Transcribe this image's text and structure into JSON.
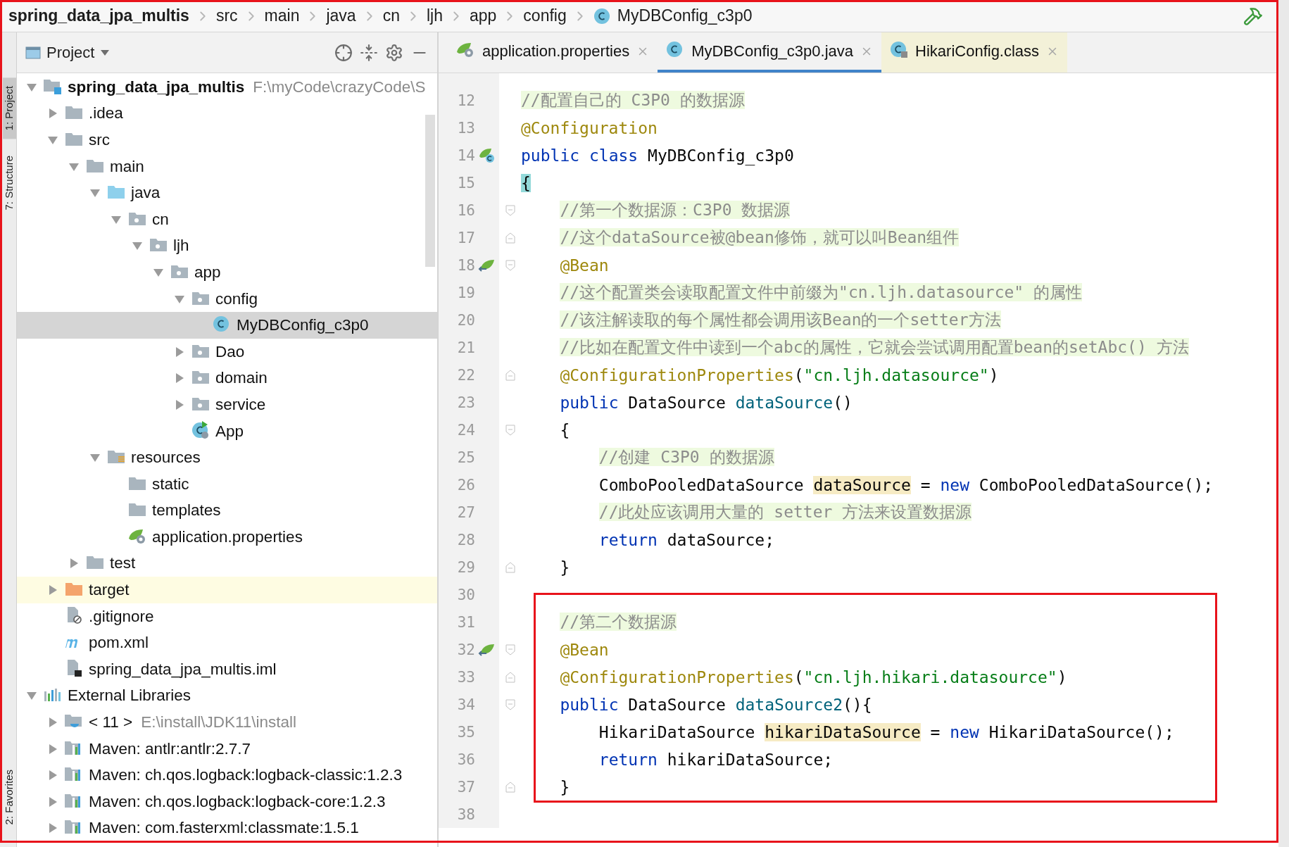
{
  "breadcrumbs": [
    {
      "label": "spring_data_jpa_multis",
      "kind": "project"
    },
    {
      "label": "src",
      "kind": "folder"
    },
    {
      "label": "main",
      "kind": "folder"
    },
    {
      "label": "java",
      "kind": "folder"
    },
    {
      "label": "cn",
      "kind": "folder"
    },
    {
      "label": "ljh",
      "kind": "folder"
    },
    {
      "label": "app",
      "kind": "folder"
    },
    {
      "label": "config",
      "kind": "folder"
    },
    {
      "label": "MyDBConfig_c3p0",
      "kind": "class"
    }
  ],
  "tool_strip": [
    {
      "label": "1: Project",
      "kind": "top",
      "selected": true
    },
    {
      "label": "7: Structure",
      "kind": "top",
      "selected": false
    },
    {
      "label": "2: Favorites",
      "kind": "bottom",
      "selected": false
    }
  ],
  "project_panel": {
    "title": "Project",
    "tree": [
      {
        "label": "spring_data_jpa_multis",
        "path": "F:\\myCode\\crazyCode\\S",
        "kind": "module",
        "expanded": true,
        "selected": false,
        "excluded": false,
        "children": [
          {
            "label": ".idea",
            "kind": "folder",
            "expanded": false,
            "selected": false,
            "excluded": false
          },
          {
            "label": "src",
            "kind": "folder",
            "expanded": true,
            "selected": false,
            "excluded": false,
            "children": [
              {
                "label": "main",
                "kind": "folder",
                "expanded": true,
                "selected": false,
                "excluded": false,
                "children": [
                  {
                    "label": "java",
                    "kind": "source",
                    "expanded": true,
                    "selected": false,
                    "excluded": false,
                    "children": [
                      {
                        "label": "cn",
                        "kind": "package",
                        "expanded": true,
                        "selected": false,
                        "excluded": false,
                        "children": [
                          {
                            "label": "ljh",
                            "kind": "package",
                            "expanded": true,
                            "selected": false,
                            "excluded": false,
                            "children": [
                              {
                                "label": "app",
                                "kind": "package",
                                "expanded": true,
                                "selected": false,
                                "excluded": false,
                                "children": [
                                  {
                                    "label": "config",
                                    "kind": "package",
                                    "expanded": true,
                                    "selected": false,
                                    "excluded": false,
                                    "children": [
                                      {
                                        "label": "MyDBConfig_c3p0",
                                        "kind": "class",
                                        "selected": true,
                                        "excluded": false
                                      }
                                    ]
                                  },
                                  {
                                    "label": "Dao",
                                    "kind": "package",
                                    "expanded": false,
                                    "selected": false,
                                    "excluded": false
                                  },
                                  {
                                    "label": "domain",
                                    "kind": "package",
                                    "expanded": false,
                                    "selected": false,
                                    "excluded": false
                                  },
                                  {
                                    "label": "service",
                                    "kind": "package",
                                    "expanded": false,
                                    "selected": false,
                                    "excluded": false
                                  },
                                  {
                                    "label": "App",
                                    "kind": "boot_class",
                                    "selected": false,
                                    "excluded": false
                                  }
                                ]
                              }
                            ]
                          }
                        ]
                      }
                    ]
                  },
                  {
                    "label": "resources",
                    "kind": "resources",
                    "expanded": true,
                    "selected": false,
                    "excluded": false,
                    "children": [
                      {
                        "label": "static",
                        "kind": "folder",
                        "selected": false,
                        "excluded": false
                      },
                      {
                        "label": "templates",
                        "kind": "folder",
                        "selected": false,
                        "excluded": false
                      },
                      {
                        "label": "application.properties",
                        "kind": "spring",
                        "selected": false,
                        "excluded": false
                      }
                    ]
                  }
                ]
              },
              {
                "label": "test",
                "kind": "folder",
                "expanded": false,
                "selected": false,
                "excluded": false
              }
            ]
          },
          {
            "label": "target",
            "kind": "excluded_folder",
            "expanded": false,
            "selected": false,
            "excluded": true
          },
          {
            "label": ".gitignore",
            "kind": "ignore_file",
            "selected": false,
            "excluded": false
          },
          {
            "label": "pom.xml",
            "kind": "maven",
            "selected": false,
            "excluded": false
          },
          {
            "label": "spring_data_jpa_multis.iml",
            "kind": "iml_file",
            "selected": false,
            "excluded": false
          }
        ]
      },
      {
        "label": "External Libraries",
        "kind": "libraries",
        "expanded": true,
        "selected": false,
        "excluded": false,
        "children": [
          {
            "label": "< 11 >",
            "path": "E:\\install\\JDK11\\install",
            "kind": "jdk",
            "expanded": false,
            "selected": false,
            "excluded": false
          },
          {
            "label": "Maven: antlr:antlr:2.7.7",
            "kind": "library",
            "expanded": false,
            "selected": false,
            "excluded": false
          },
          {
            "label": "Maven: ch.qos.logback:logback-classic:1.2.3",
            "kind": "library",
            "expanded": false,
            "selected": false,
            "excluded": false
          },
          {
            "label": "Maven: ch.qos.logback:logback-core:1.2.3",
            "kind": "library",
            "expanded": false,
            "selected": false,
            "excluded": false
          },
          {
            "label": "Maven: com.fasterxml:classmate:1.5.1",
            "kind": "library",
            "expanded": false,
            "selected": false,
            "excluded": false
          }
        ]
      }
    ]
  },
  "editor_tabs": [
    {
      "label": "application.properties",
      "kind": "spring",
      "selected": false,
      "library": false
    },
    {
      "label": "MyDBConfig_c3p0.java",
      "kind": "class",
      "selected": true,
      "library": false
    },
    {
      "label": "HikariConfig.class",
      "kind": "locked_class",
      "selected": false,
      "library": true
    }
  ],
  "code_lines": [
    {
      "number": "12",
      "boxed": false,
      "tokens": [
        {
          "kind": "comment",
          "text": "//配置自己的 C3P0 的数据源"
        }
      ]
    },
    {
      "number": "13",
      "boxed": false,
      "tokens": [
        {
          "kind": "annotation",
          "text": "@Configuration"
        }
      ]
    },
    {
      "number": "14",
      "boxed": false,
      "gutter": [
        {
          "kind": "bean_class"
        }
      ],
      "tokens": [
        {
          "kind": "keyword",
          "text": "public"
        },
        {
          "kind": "keyword",
          "text": " class"
        },
        {
          "kind": "plain",
          "text": " MyDBConfig_c3p0"
        }
      ]
    },
    {
      "number": "15",
      "boxed": false,
      "tokens": [
        {
          "kind": "brace_match",
          "text": "{"
        }
      ]
    },
    {
      "number": "16",
      "boxed": false,
      "gutter": [
        {
          "kind": "fold_open"
        }
      ],
      "tokens": [
        {
          "kind": "comment",
          "text": "    //第一个数据源：C3P0 数据源"
        }
      ]
    },
    {
      "number": "17",
      "boxed": false,
      "gutter": [
        {
          "kind": "fold_close"
        }
      ],
      "tokens": [
        {
          "kind": "comment",
          "text": "    //这个dataSource被@bean修饰，就可以叫Bean组件"
        }
      ]
    },
    {
      "number": "18",
      "boxed": false,
      "gutter": [
        {
          "kind": "bean"
        },
        {
          "kind": "fold_open"
        }
      ],
      "tokens": [
        {
          "kind": "annotation",
          "text": "    @Bean"
        }
      ]
    },
    {
      "number": "19",
      "boxed": false,
      "tokens": [
        {
          "kind": "comment",
          "text": "    //这个配置类会读取配置文件中前缀为\"cn.ljh.datasource\" 的属性"
        }
      ]
    },
    {
      "number": "20",
      "boxed": false,
      "tokens": [
        {
          "kind": "comment",
          "text": "    //该注解读取的每个属性都会调用该Bean的一个setter方法"
        }
      ]
    },
    {
      "number": "21",
      "boxed": false,
      "tokens": [
        {
          "kind": "comment",
          "text": "    //比如在配置文件中读到一个abc的属性，它就会尝试调用配置bean的setAbc() 方法"
        }
      ]
    },
    {
      "number": "22",
      "boxed": false,
      "gutter": [
        {
          "kind": "fold_close"
        }
      ],
      "tokens": [
        {
          "kind": "annotation",
          "text": "    @ConfigurationProperties"
        },
        {
          "kind": "plain",
          "text": "("
        },
        {
          "kind": "string",
          "text": "\"cn.ljh.datasource\""
        },
        {
          "kind": "plain",
          "text": ")"
        }
      ]
    },
    {
      "number": "23",
      "boxed": false,
      "tokens": [
        {
          "kind": "keyword",
          "text": "    public"
        },
        {
          "kind": "plain",
          "text": " DataSource "
        },
        {
          "kind": "method",
          "text": "dataSource"
        },
        {
          "kind": "plain",
          "text": "()"
        }
      ]
    },
    {
      "number": "24",
      "boxed": false,
      "gutter": [
        {
          "kind": "fold_open"
        }
      ],
      "tokens": [
        {
          "kind": "plain",
          "text": "    {"
        }
      ]
    },
    {
      "number": "25",
      "boxed": false,
      "tokens": [
        {
          "kind": "comment",
          "text": "        //创建 C3P0 的数据源"
        }
      ]
    },
    {
      "number": "26",
      "boxed": false,
      "tokens": [
        {
          "kind": "plain",
          "text": "        ComboPooledDataSource "
        },
        {
          "kind": "usage",
          "text": "dataSource"
        },
        {
          "kind": "plain",
          "text": " = "
        },
        {
          "kind": "keyword",
          "text": "new"
        },
        {
          "kind": "plain",
          "text": " ComboPooledDataSource();"
        }
      ]
    },
    {
      "number": "27",
      "boxed": false,
      "tokens": [
        {
          "kind": "comment",
          "text": "        //此处应该调用大量的 setter 方法来设置数据源"
        }
      ]
    },
    {
      "number": "28",
      "boxed": false,
      "tokens": [
        {
          "kind": "keyword",
          "text": "        return"
        },
        {
          "kind": "plain",
          "text": " dataSource;"
        }
      ]
    },
    {
      "number": "29",
      "boxed": false,
      "gutter": [
        {
          "kind": "fold_close"
        }
      ],
      "tokens": [
        {
          "kind": "plain",
          "text": "    }"
        }
      ]
    },
    {
      "number": "30",
      "boxed": false
    },
    {
      "number": "31",
      "boxed": true,
      "tokens": [
        {
          "kind": "comment",
          "text": "    //第二个数据源"
        }
      ]
    },
    {
      "number": "32",
      "boxed": true,
      "gutter": [
        {
          "kind": "bean"
        },
        {
          "kind": "fold_open"
        }
      ],
      "tokens": [
        {
          "kind": "annotation",
          "text": "    @Bean"
        }
      ]
    },
    {
      "number": "33",
      "boxed": true,
      "gutter": [
        {
          "kind": "fold_close"
        }
      ],
      "tokens": [
        {
          "kind": "annotation",
          "text": "    @ConfigurationProperties"
        },
        {
          "kind": "plain",
          "text": "("
        },
        {
          "kind": "string",
          "text": "\"cn.ljh.hikari.datasource\""
        },
        {
          "kind": "plain",
          "text": ")"
        }
      ]
    },
    {
      "number": "34",
      "boxed": true,
      "gutter": [
        {
          "kind": "fold_open"
        }
      ],
      "tokens": [
        {
          "kind": "keyword",
          "text": "    public"
        },
        {
          "kind": "plain",
          "text": " DataSource "
        },
        {
          "kind": "method",
          "text": "dataSource2"
        },
        {
          "kind": "plain",
          "text": "(){"
        }
      ]
    },
    {
      "number": "35",
      "boxed": true,
      "tokens": [
        {
          "kind": "plain",
          "text": "        HikariDataSource "
        },
        {
          "kind": "usage",
          "text": "hikariDataSource"
        },
        {
          "kind": "plain",
          "text": " = "
        },
        {
          "kind": "keyword",
          "text": "new"
        },
        {
          "kind": "plain",
          "text": " HikariDataSource();"
        }
      ]
    },
    {
      "number": "36",
      "boxed": true,
      "tokens": [
        {
          "kind": "keyword",
          "text": "        return"
        },
        {
          "kind": "plain",
          "text": " hikariDataSource;"
        }
      ]
    },
    {
      "number": "37",
      "boxed": true,
      "gutter": [
        {
          "kind": "fold_close"
        }
      ],
      "tokens": [
        {
          "kind": "plain",
          "text": "    }"
        }
      ]
    },
    {
      "number": "38",
      "boxed": false
    }
  ]
}
